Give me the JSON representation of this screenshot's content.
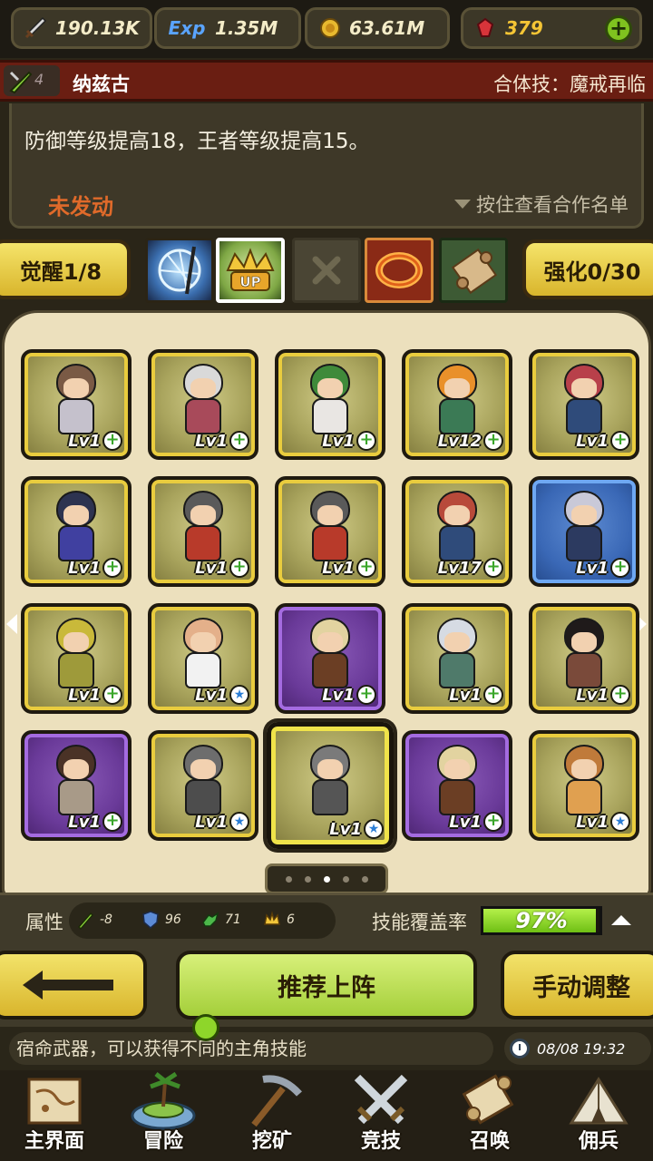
{
  "resources": {
    "attack": "190.13K",
    "exp_label": "Exp",
    "exp": "1.35M",
    "gold": "63.61M",
    "gems": "379"
  },
  "hero": {
    "rank": "4",
    "name": "纳兹古",
    "combo_skill": "合体技：魔戒再临"
  },
  "description": {
    "text": "防御等级提高18，王者等级提高15。",
    "status": "未发动",
    "hold_hint": "按住查看合作名单"
  },
  "awaken_button": "觉醒1/8",
  "enhance_button": "强化0/30",
  "slots": [
    {
      "icon": "magic-circle-icon",
      "label": ""
    },
    {
      "icon": "crown-up-icon",
      "label": "UP"
    },
    {
      "icon": "empty-x-icon",
      "label": ""
    },
    {
      "icon": "ring-icon",
      "label": ""
    },
    {
      "icon": "scroll-icon",
      "label": ""
    }
  ],
  "heroes": [
    {
      "level": "Lv1",
      "badge": "plus",
      "frame": "gold",
      "hair": "#7a5a45",
      "cloth": "#c5c1cc"
    },
    {
      "level": "Lv1",
      "badge": "plus",
      "frame": "gold",
      "hair": "#d9d9d9",
      "cloth": "#a84a5a"
    },
    {
      "level": "Lv1",
      "badge": "plus",
      "frame": "gold",
      "hair": "#3f8a3a",
      "cloth": "#e9e6e3"
    },
    {
      "level": "Lv12",
      "badge": "plus",
      "frame": "gold",
      "hair": "#e9902a",
      "cloth": "#3b7a55"
    },
    {
      "level": "Lv1",
      "badge": "plus",
      "frame": "gold",
      "hair": "#b8404a",
      "cloth": "#2f4b7a"
    },
    {
      "level": "Lv1",
      "badge": "plus",
      "frame": "gold",
      "hair": "#2d3350",
      "cloth": "#4040a0"
    },
    {
      "level": "Lv1",
      "badge": "plus",
      "frame": "gold",
      "hair": "#5a5a5a",
      "cloth": "#b83a2a"
    },
    {
      "level": "Lv1",
      "badge": "plus",
      "frame": "gold",
      "hair": "#5a5a5a",
      "cloth": "#b83a2a"
    },
    {
      "level": "Lv17",
      "badge": "plus",
      "frame": "gold",
      "hair": "#b84a3a",
      "cloth": "#2f4b7a"
    },
    {
      "level": "Lv1",
      "badge": "plus",
      "frame": "blue",
      "hair": "#c9c9d8",
      "cloth": "#2c3a60"
    },
    {
      "level": "Lv1",
      "badge": "plus",
      "frame": "gold",
      "hair": "#c9b93a",
      "cloth": "#9e9a3a"
    },
    {
      "level": "Lv1",
      "badge": "star",
      "frame": "gold",
      "hair": "#e4b08a",
      "cloth": "#f2f2f2"
    },
    {
      "level": "Lv1",
      "badge": "plus",
      "frame": "purple",
      "hair": "#e2d3a0",
      "cloth": "#6b3e24"
    },
    {
      "level": "Lv1",
      "badge": "plus",
      "frame": "gold",
      "hair": "#d6dbe3",
      "cloth": "#4f7a6a"
    },
    {
      "level": "Lv1",
      "badge": "plus",
      "frame": "gold",
      "hair": "#1f1a1a",
      "cloth": "#7a4a3a"
    },
    {
      "level": "Lv1",
      "badge": "plus",
      "frame": "purple",
      "hair": "#4a3226",
      "cloth": "#a89a88"
    },
    {
      "level": "Lv1",
      "badge": "star",
      "frame": "gold",
      "hair": "#6d6d6d",
      "cloth": "#4d4d4d"
    },
    {
      "level": "Lv1",
      "badge": "star",
      "frame": "gold",
      "hair": "#7a7a7a",
      "cloth": "#555555",
      "selected": true
    },
    {
      "level": "Lv1",
      "badge": "plus",
      "frame": "purple",
      "hair": "#e2d3a0",
      "cloth": "#6b3e24"
    },
    {
      "level": "Lv1",
      "badge": "star",
      "frame": "gold",
      "hair": "#c07a3a",
      "cloth": "#e0a050"
    }
  ],
  "pager": {
    "pages": 5,
    "current": 3
  },
  "attributes": {
    "label": "属性",
    "sword": "-8",
    "shield": "96",
    "dragon": "71",
    "crown": "6",
    "coverage_label": "技能覆盖率",
    "coverage": "97%",
    "coverage_value": 0.97
  },
  "actions": {
    "recommend": "推荐上阵",
    "manual": "手动调整"
  },
  "ticker": {
    "text": "宿命武器，可以获得不同的主角技能",
    "time": "08/08 19:32"
  },
  "nav": [
    {
      "label": "主界面",
      "icon": "map-scroll-icon"
    },
    {
      "label": "冒险",
      "icon": "island-icon"
    },
    {
      "label": "挖矿",
      "icon": "pickaxe-icon"
    },
    {
      "label": "竞技",
      "icon": "crossed-swords-icon"
    },
    {
      "label": "召唤",
      "icon": "summon-scroll-icon"
    },
    {
      "label": "佣兵",
      "icon": "tent-icon"
    }
  ],
  "colors": {
    "accent_green": "#7fc21f",
    "frame_gold": "#e9cc3e",
    "frame_purple": "#a46be0",
    "frame_blue": "#6ea8f2",
    "status_orange": "#e06a2a"
  }
}
